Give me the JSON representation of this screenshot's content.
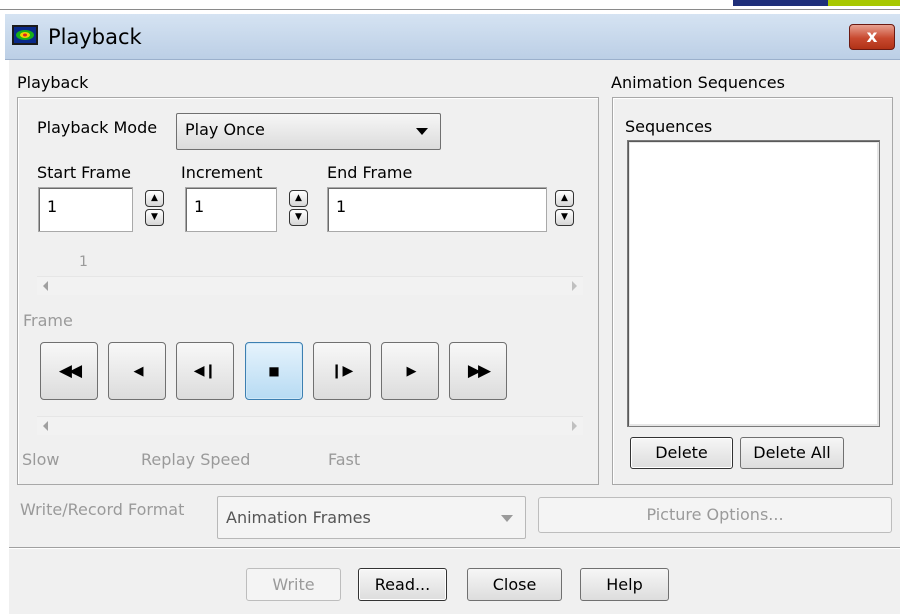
{
  "window": {
    "title": "Playback",
    "close_glyph": "x"
  },
  "playback": {
    "group_label": "Playback",
    "mode_label": "Playback Mode",
    "mode_value": "Play Once",
    "start_label": "Start Frame",
    "start_value": "1",
    "increment_label": "Increment",
    "increment_value": "1",
    "end_label": "End Frame",
    "end_value": "1",
    "frame_slider_value": "1",
    "frame_label": "Frame",
    "controls": [
      "skip-to-start",
      "step-back",
      "step-back-frame",
      "stop",
      "step-forward-frame",
      "play",
      "skip-to-end"
    ],
    "speed_slow": "Slow",
    "speed_label": "Replay Speed",
    "speed_fast": "Fast"
  },
  "animation": {
    "group_label": "Animation Sequences",
    "list_label": "Sequences",
    "items": [],
    "delete_label": "Delete",
    "delete_all_label": "Delete All"
  },
  "format": {
    "label": "Write/Record Format",
    "value": "Animation Frames",
    "picture_options_label": "Picture Options..."
  },
  "buttons": {
    "write": "Write",
    "read": "Read...",
    "close": "Close",
    "help": "Help"
  },
  "colors": {
    "title_bar": "#c9dbef",
    "close_button": "#c8492f",
    "active_button": "#b7dbf3",
    "dialog_bg": "#f0f0f0"
  }
}
